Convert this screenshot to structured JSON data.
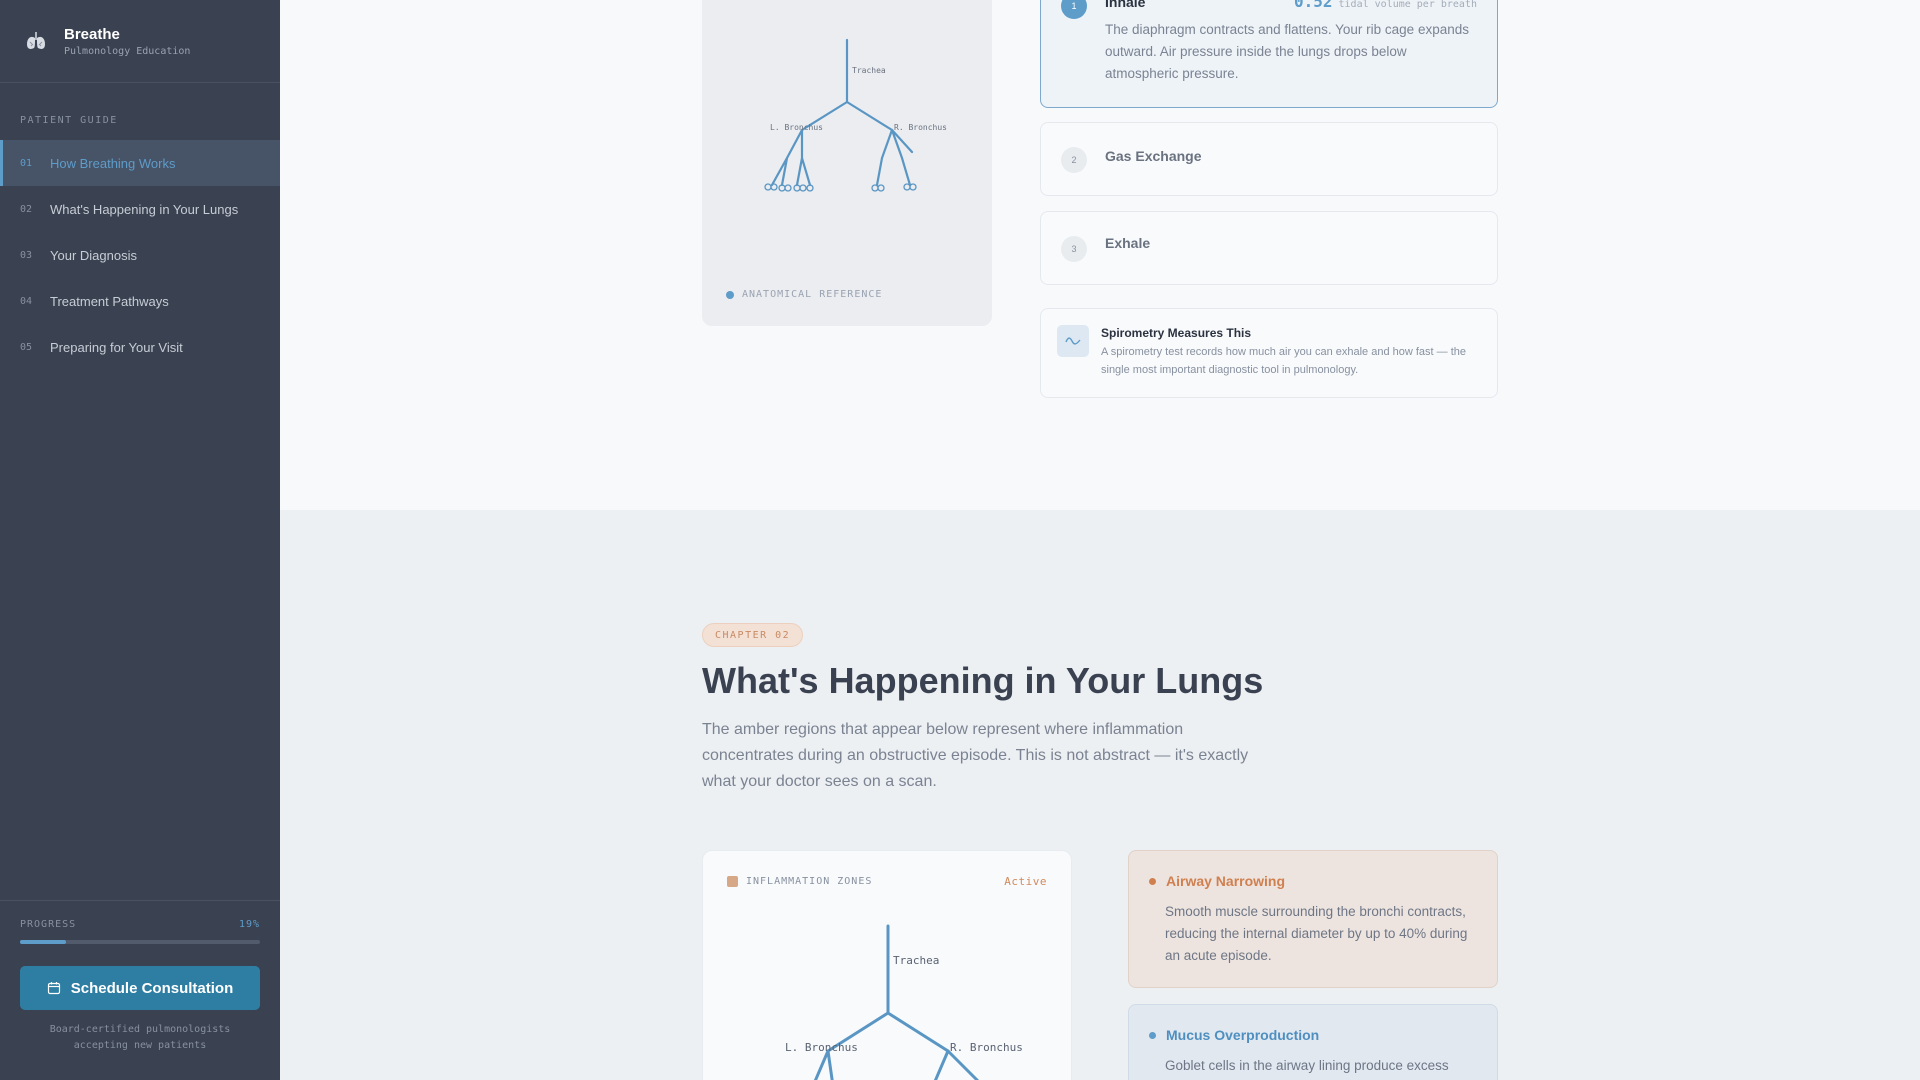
{
  "sidebar": {
    "brand_title": "Breathe",
    "brand_subtitle": "Pulmonology Education",
    "section_label": "PATIENT GUIDE",
    "items": [
      {
        "num": "01",
        "label": "How Breathing Works",
        "active": true
      },
      {
        "num": "02",
        "label": "What's Happening in Your Lungs",
        "active": false
      },
      {
        "num": "03",
        "label": "Your Diagnosis",
        "active": false
      },
      {
        "num": "04",
        "label": "Treatment Pathways",
        "active": false
      },
      {
        "num": "05",
        "label": "Preparing for Your Visit",
        "active": false
      }
    ],
    "progress_label": "PROGRESS",
    "progress_value": "19%",
    "progress_fraction": 0.19,
    "cta_label": "Schedule Consultation",
    "cta_note": "Board-certified pulmonologists accepting new patients"
  },
  "section1": {
    "diagram_labels": {
      "trachea": "Trachea",
      "left": "L. Bronchus",
      "right": "R. Bronchus"
    },
    "ref_label": "ANATOMICAL REFERENCE",
    "steps": [
      {
        "num": "1",
        "title": "Inhale",
        "stat_value": "0.52",
        "stat_unit": "tidal volume per breath",
        "body": "The diaphragm contracts and flattens. Your rib cage expands outward. Air pressure inside the lungs drops below atmospheric pressure.",
        "active": true
      },
      {
        "num": "2",
        "title": "Gas Exchange",
        "active": false
      },
      {
        "num": "3",
        "title": "Exhale",
        "active": false
      }
    ],
    "info": {
      "title": "Spirometry Measures This",
      "body": "A spirometry test records how much air you can exhale and how fast — the single most important diagnostic tool in pulmonology."
    }
  },
  "section2": {
    "chapter": "CHAPTER 02",
    "title": "What's Happening in Your Lungs",
    "lead": "The amber regions that appear below represent where inflammation concentrates during an obstructive episode. This is not abstract — it's exactly what your doctor sees on a scan.",
    "zones_label": "INFLAMMATION ZONES",
    "zones_status": "Active",
    "diagram_labels": {
      "trachea": "Trachea",
      "left": "L. Bronchus",
      "right": "R. Bronchus"
    },
    "cards": [
      {
        "title": "Airway Narrowing",
        "body": "Smooth muscle surrounding the bronchi contracts, reducing the internal diameter by up to 40% during an acute episode."
      },
      {
        "title": "Mucus Overproduction",
        "body": "Goblet cells in the airway lining produce excess"
      }
    ]
  },
  "colors": {
    "accent": "#5e9cc9",
    "amber": "#d0804f",
    "sidebar_bg": "#3a4150",
    "cta": "#2e7ea3"
  }
}
